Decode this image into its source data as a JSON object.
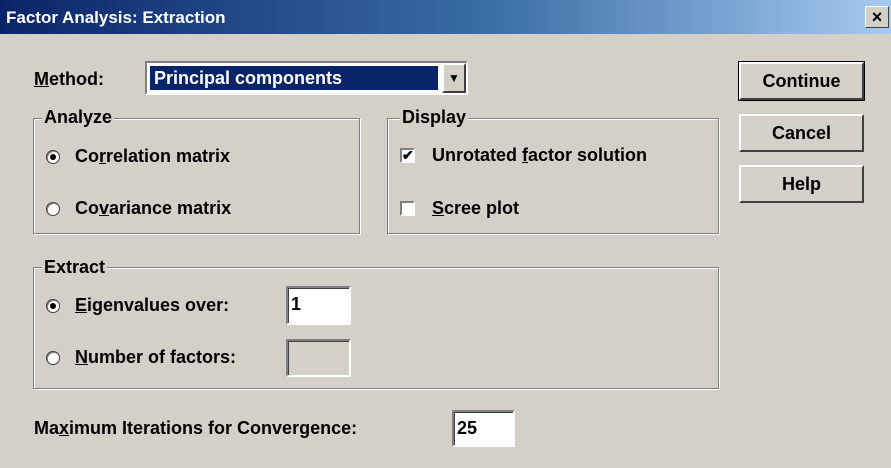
{
  "window": {
    "title": "Factor Analysis: Extraction",
    "close_glyph": "×"
  },
  "method": {
    "label_underlined": "M",
    "label_rest": "ethod:",
    "selected": "Principal components",
    "arrow": "▼"
  },
  "analyze": {
    "title": "Analyze",
    "correlation": {
      "pre": "Co",
      "ul": "r",
      "post": "relation matrix",
      "selected": true
    },
    "covariance": {
      "pre": "Co",
      "ul": "v",
      "post": "ariance matrix",
      "selected": false
    }
  },
  "display": {
    "title": "Display",
    "unrotated": {
      "pre": "Unrotated ",
      "ul": "f",
      "post": "actor solution",
      "checked": true,
      "mark": "✔"
    },
    "scree": {
      "pre": "",
      "ul": "S",
      "post": "cree plot",
      "checked": false
    }
  },
  "extract": {
    "title": "Extract",
    "eigen": {
      "ul": "E",
      "post": "igenvalues over:",
      "value": "1",
      "selected": true
    },
    "nfactors": {
      "ul": "N",
      "post": "umber of factors:",
      "value": "",
      "selected": false
    }
  },
  "iterations": {
    "pre": "Ma",
    "ul": "x",
    "post": "imum Iterations for Convergence:",
    "value": "25"
  },
  "buttons": {
    "continue": "Continue",
    "cancel": "Cancel",
    "help": "Help"
  }
}
